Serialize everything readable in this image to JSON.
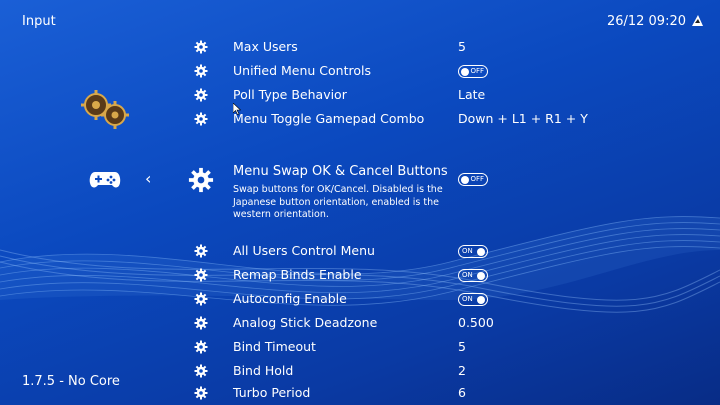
{
  "header": {
    "title": "Input",
    "clock": "26/12 09:20"
  },
  "footer": {
    "version": "1.7.5 - No Core"
  },
  "icons": {
    "context": "input-gears-icon",
    "tab": "gamepad-icon",
    "back": "chevron-left-icon",
    "setting": "gear-icon",
    "battery": "battery-icon"
  },
  "nav": {
    "back_glyph": "‹"
  },
  "rows_top": [
    {
      "label": "Max Users",
      "value": "5"
    },
    {
      "label": "Unified Menu Controls",
      "toggle": "OFF"
    },
    {
      "label": "Poll Type Behavior",
      "value": "Late"
    },
    {
      "label": "Menu Toggle Gamepad Combo",
      "value": "Down + L1 + R1 + Y"
    }
  ],
  "selected": {
    "label": "Menu Swap OK & Cancel Buttons",
    "description": "Swap buttons for OK/Cancel. Disabled is the Japanese button orientation, enabled is the western orientation.",
    "toggle": "OFF"
  },
  "rows_bottom": [
    {
      "label": "All Users Control Menu",
      "toggle": "ON"
    },
    {
      "label": "Remap Binds Enable",
      "toggle": "ON"
    },
    {
      "label": "Autoconfig Enable",
      "toggle": "ON"
    },
    {
      "label": "Analog Stick Deadzone",
      "value": "0.500"
    },
    {
      "label": "Bind Timeout",
      "value": "5"
    },
    {
      "label": "Bind Hold",
      "value": "2"
    },
    {
      "label": "Turbo Period",
      "value": "6"
    }
  ]
}
